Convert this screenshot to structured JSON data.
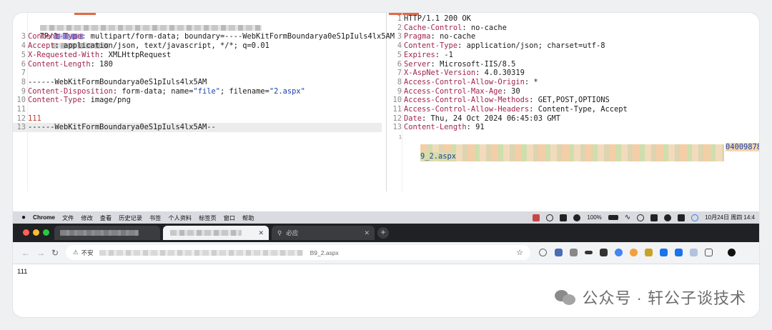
{
  "request": {
    "first_line_suffix": "TP/1.1",
    "lines": [
      {
        "n": "3",
        "key": "Content-Type",
        "val": " multipart/form-data; boundary=----WebKitFormBoundarya0eS1pIuls4lx5AM"
      },
      {
        "n": "4",
        "key": "Accept",
        "val": " application/json, text/javascript, */*; q=0.01"
      },
      {
        "n": "5",
        "key": "X-Requested-With",
        "val": " XMLHttpRequest"
      },
      {
        "n": "6",
        "key": "Content-Length",
        "val": " 180"
      }
    ],
    "line7_n": "7",
    "line8_n": "8",
    "line8": "------WebKitFormBoundarya0eS1pIuls4lx5AM",
    "line9_n": "9",
    "line9_key": "Content-Disposition",
    "line9_a": " form-data; name=",
    "line9_name": "\"file\"",
    "line9_b": "; filename=",
    "line9_file": "\"2.aspx\"",
    "line10_n": "10",
    "line10_key": "Content-Type",
    "line10_val": " image/png",
    "line11_n": "11",
    "line12_n": "12",
    "line12": "111",
    "line13_n": "13",
    "line13": "------WebKitFormBoundarya0eS1pIuls4lx5AM--"
  },
  "response": {
    "lines": [
      {
        "n": "1",
        "key": "",
        "val": "HTTP/1.1 200 OK"
      },
      {
        "n": "2",
        "key": "Cache-Control",
        "val": " no-cache"
      },
      {
        "n": "3",
        "key": "Pragma",
        "val": " no-cache"
      },
      {
        "n": "4",
        "key": "Content-Type",
        "val": " application/json; charset=utf-8"
      },
      {
        "n": "5",
        "key": "Expires",
        "val": " -1"
      },
      {
        "n": "6",
        "key": "Server",
        "val": " Microsoft-IIS/8.5"
      },
      {
        "n": "7",
        "key": "X-AspNet-Version",
        "val": " 4.0.30319"
      },
      {
        "n": "8",
        "key": "Access-Control-Allow-Origin",
        "val": " *"
      },
      {
        "n": "9",
        "key": "Access-Control-Max-Age",
        "val": " 30"
      },
      {
        "n": "10",
        "key": "Access-Control-Allow-Methods",
        "val": " GET,POST,OPTIONS"
      },
      {
        "n": "11",
        "key": "Access-Control-Allow-Headers",
        "val": " Content-Type, Accept"
      },
      {
        "n": "12",
        "key": "Date",
        "val": " Thu, 24 Oct 2024 06:45:03 GMT"
      },
      {
        "n": "13",
        "key": "Content-Length",
        "val": " 91"
      }
    ],
    "body_tail": "04009878",
    "body_line2": "9_2.aspx"
  },
  "menubar": {
    "app": "Chrome",
    "items": [
      "文件",
      "修改",
      "查看",
      "历史记录",
      "书签",
      "个人资料",
      "标签页",
      "窗口",
      "帮助"
    ],
    "battery": "100%",
    "datetime": "10月24日 周四 14:4"
  },
  "browser": {
    "tab2_title": "必应",
    "url_prefix": "不安",
    "url_suffix": "B9_2.aspx"
  },
  "page": {
    "body_text": "111"
  },
  "watermark": {
    "text": "公众号 · 轩公子谈技术"
  },
  "colors": {
    "key": "#a0244f",
    "string": "#1d3fa8",
    "number": "#c03a2b",
    "tab_accent": "#e06b48"
  }
}
